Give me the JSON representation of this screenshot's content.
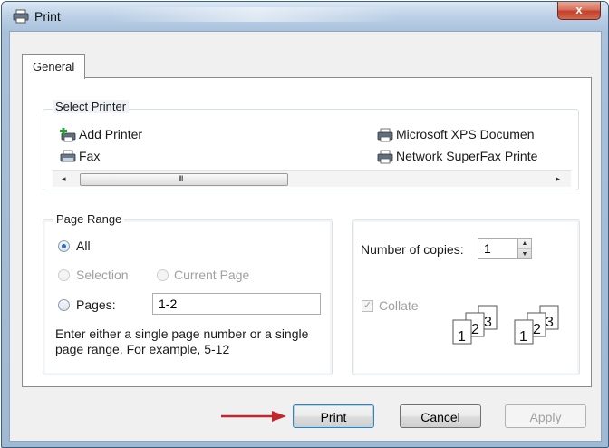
{
  "window": {
    "title": "Print",
    "close_label": "x"
  },
  "tabs": [
    {
      "label": "General",
      "active": true
    }
  ],
  "select_printer": {
    "label": "Select Printer",
    "printers": [
      {
        "name": "Add Printer",
        "icon": "add-printer-icon"
      },
      {
        "name": "Fax",
        "icon": "fax-icon"
      },
      {
        "name": "Microsoft XPS Documen",
        "icon": "printer-icon"
      },
      {
        "name": "Network SuperFax Printe",
        "icon": "printer-icon"
      }
    ],
    "scrollbar": {
      "left_arrow": "◂",
      "right_arrow": "▸",
      "grip": "III"
    }
  },
  "page_range": {
    "label": "Page Range",
    "options": [
      {
        "label": "All",
        "checked": true,
        "enabled": true
      },
      {
        "label": "Selection",
        "checked": false,
        "enabled": false
      },
      {
        "label": "Current Page",
        "checked": false,
        "enabled": false
      },
      {
        "label": "Pages:",
        "checked": false,
        "enabled": true
      }
    ],
    "pages_value": "1-2",
    "hint": "Enter either a single page number or a single page range.  For example, 5-12"
  },
  "copies": {
    "label": "Number of copies:",
    "value": "1",
    "collate_label": "Collate",
    "collate_checked": true,
    "collate_enabled": false,
    "collate_numbers": [
      "1",
      "2",
      "3"
    ]
  },
  "buttons": {
    "print": "Print",
    "cancel": "Cancel",
    "apply": "Apply"
  },
  "colors": {
    "arrow": "#c1272d",
    "accent": "#3c7fb1",
    "titlebar": "#bcd0e6",
    "close": "#c4402a"
  }
}
